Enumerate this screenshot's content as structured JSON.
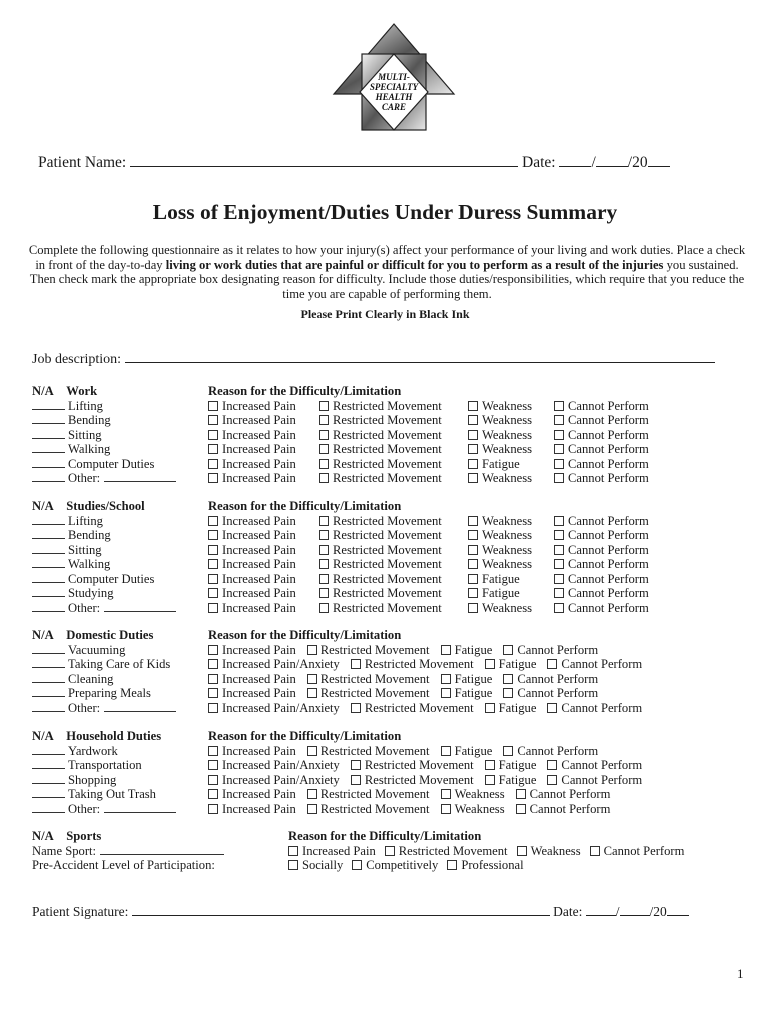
{
  "logo": {
    "lines": [
      "MULTI-",
      "SPECIALTY",
      "HEALTH",
      "CARE"
    ]
  },
  "patient_name_label": "Patient Name:",
  "date_label": "Date:",
  "date_slash": "/",
  "date_year_prefix": "/20",
  "title": "Loss of Enjoyment/Duties Under Duress Summary",
  "intro": {
    "part1": "Complete the following questionnaire as it relates to how your injury(s) affect your performance of your living and work duties. Place a check in front of the day-to-day ",
    "bold": "living or work duties that are painful or difficult for you to perform as a result of the injuries",
    "part2": " you sustained.  Then check mark the appropriate box designating reason for difficulty.  Include those duties/responsibilities, which require that you reduce the time you are capable of performing them."
  },
  "print_note": "Please Print Clearly in Black Ink",
  "job_description_label": "Job description:",
  "reason_header": "Reason for the Difficulty/Limitation",
  "na_label": "N/A",
  "sections": [
    {
      "name": "Work",
      "items": [
        {
          "label": "Lifting",
          "options": [
            "Increased Pain",
            "Restricted Movement",
            "Weakness",
            "Cannot Perform"
          ]
        },
        {
          "label": "Bending",
          "options": [
            "Increased Pain",
            "Restricted Movement",
            "Weakness",
            "Cannot Perform"
          ]
        },
        {
          "label": "Sitting",
          "options": [
            "Increased Pain",
            "Restricted Movement",
            "Weakness",
            "Cannot Perform"
          ]
        },
        {
          "label": "Walking",
          "options": [
            "Increased Pain",
            "Restricted Movement",
            "Weakness",
            "Cannot Perform"
          ]
        },
        {
          "label": "Computer Duties",
          "options": [
            "Increased Pain",
            "Restricted Movement",
            "Fatigue",
            "Cannot Perform"
          ]
        },
        {
          "label": "Other:",
          "other": true,
          "options": [
            "Increased Pain",
            "Restricted Movement",
            "Weakness",
            "Cannot Perform"
          ]
        }
      ]
    },
    {
      "name": "Studies/School",
      "items": [
        {
          "label": "Lifting",
          "options": [
            "Increased Pain",
            "Restricted Movement",
            "Weakness",
            "Cannot Perform"
          ]
        },
        {
          "label": "Bending",
          "options": [
            "Increased Pain",
            "Restricted Movement",
            "Weakness",
            "Cannot Perform"
          ]
        },
        {
          "label": "Sitting",
          "options": [
            "Increased Pain",
            "Restricted Movement",
            "Weakness",
            "Cannot Perform"
          ]
        },
        {
          "label": "Walking",
          "options": [
            "Increased Pain",
            "Restricted Movement",
            "Weakness",
            "Cannot Perform"
          ]
        },
        {
          "label": "Computer Duties",
          "options": [
            "Increased Pain",
            "Restricted Movement",
            "Fatigue",
            "Cannot Perform"
          ]
        },
        {
          "label": "Studying",
          "options": [
            "Increased Pain",
            "Restricted Movement",
            "Fatigue",
            "Cannot Perform"
          ]
        },
        {
          "label": "Other:",
          "other": true,
          "options": [
            "Increased Pain",
            "Restricted Movement",
            "Weakness",
            "Cannot Perform"
          ]
        }
      ]
    },
    {
      "name": "Domestic Duties",
      "flow": true,
      "items": [
        {
          "label": "Vacuuming",
          "options": [
            "Increased Pain",
            "Restricted Movement",
            "Fatigue",
            "Cannot Perform"
          ]
        },
        {
          "label": "Taking Care of Kids",
          "options": [
            "Increased Pain/Anxiety",
            "Restricted Movement",
            "Fatigue",
            "Cannot Perform"
          ]
        },
        {
          "label": "Cleaning",
          "options": [
            "Increased Pain",
            "Restricted Movement",
            "Fatigue",
            "Cannot Perform"
          ]
        },
        {
          "label": "Preparing Meals",
          "options": [
            "Increased Pain",
            "Restricted Movement",
            "Fatigue",
            "Cannot Perform"
          ]
        },
        {
          "label": "Other:",
          "other": true,
          "options": [
            "Increased Pain/Anxiety",
            "Restricted Movement",
            "Fatigue",
            "Cannot Perform"
          ]
        }
      ]
    },
    {
      "name": "Household Duties",
      "flow": true,
      "items": [
        {
          "label": "Yardwork",
          "options": [
            "Increased Pain",
            "Restricted Movement",
            "Fatigue",
            "Cannot Perform"
          ]
        },
        {
          "label": "Transportation",
          "options": [
            "Increased Pain/Anxiety",
            "Restricted Movement",
            "Fatigue",
            "Cannot Perform"
          ]
        },
        {
          "label": "Shopping",
          "options": [
            "Increased Pain/Anxiety",
            "Restricted Movement",
            "Fatigue",
            "Cannot Perform"
          ]
        },
        {
          "label": "Taking Out Trash",
          "options": [
            "Increased Pain",
            "Restricted Movement",
            "Weakness",
            "Cannot Perform"
          ]
        },
        {
          "label": "Other:",
          "other": true,
          "options": [
            "Increased Pain",
            "Restricted Movement",
            "Weakness",
            "Cannot Perform"
          ]
        }
      ]
    }
  ],
  "sports": {
    "name": "Sports",
    "name_sport_label": "Name Sport:",
    "pre_accident_label": "Pre-Accident Level of Participation:",
    "reason_options": [
      "Increased Pain",
      "Restricted Movement",
      "Weakness",
      "Cannot Perform"
    ],
    "participation_options": [
      "Socially",
      "Competitively",
      "Professional"
    ]
  },
  "signature_label": "Patient Signature:",
  "page_number": "1"
}
